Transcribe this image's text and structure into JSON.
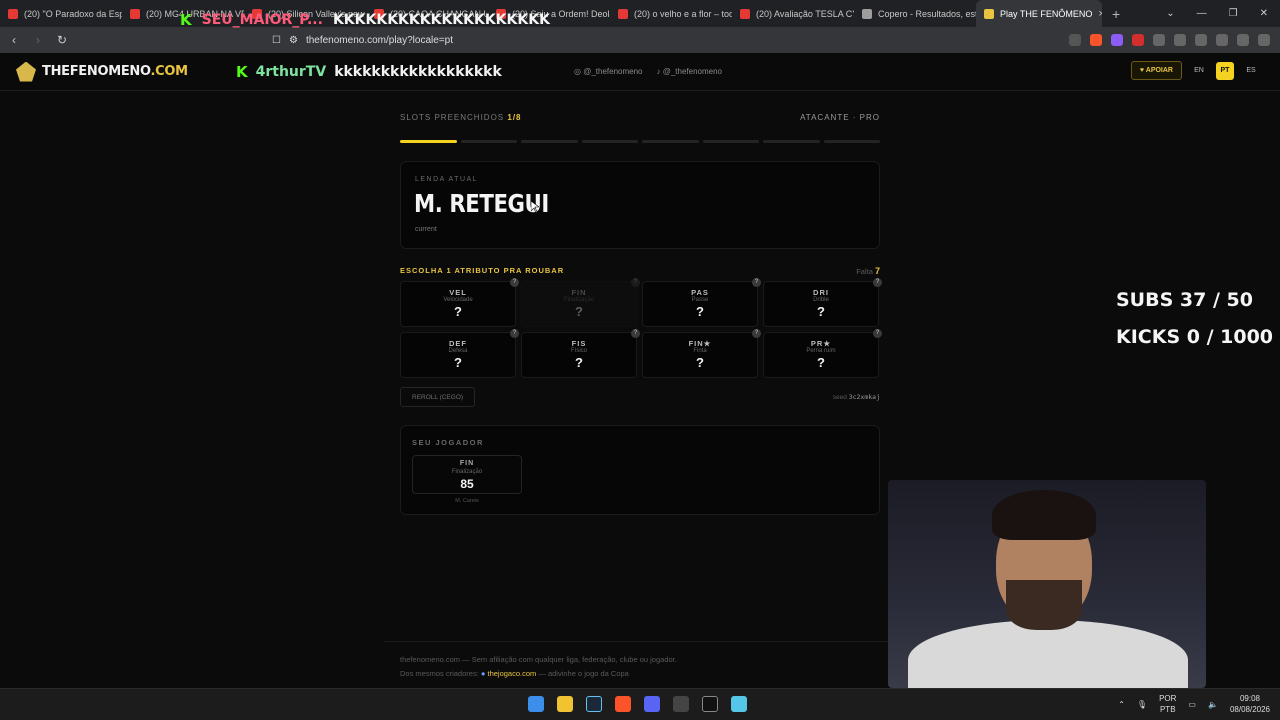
{
  "browser": {
    "tabs": [
      {
        "title": "(20) \"O Paradoxo da Espe",
        "color": "#e53935"
      },
      {
        "title": "(20) MG4 URBAN NA VE",
        "color": "#e53935"
      },
      {
        "title": "(20) Silicon Valley's new",
        "color": "#e53935"
      },
      {
        "title": "(20) CAOA CHANGAN UN",
        "color": "#e53935"
      },
      {
        "title": "(20) Saiu a Ordem! Deola",
        "color": "#e53935"
      },
      {
        "title": "(20) o velho e a flor – toq",
        "color": "#e53935"
      },
      {
        "title": "(20) Avaliação TESLA CYB",
        "color": "#e53935"
      },
      {
        "title": "Copero - Resultados, esta",
        "color": "#9e9e9e"
      }
    ],
    "active_tab": "Play THE FENÔMENO",
    "url": "thefenomeno.com/play?locale=pt"
  },
  "overlay": {
    "chat_user": "SEU_MAIOR_P...",
    "chat_msg": "KKKKKKKKKKKKKKKKKKKK",
    "subs": "SUBS 37 / 50",
    "kicks": "KICKS 0 / 1000"
  },
  "header": {
    "logo_main": "THEFENOMENO",
    "logo_dom": ".COM",
    "chat_user": "4rthurTV",
    "chat_msg": "kkkkkkkkkkkkkkkkkk",
    "social1": "@_thefenomeno",
    "social2": "@_thefenomeno",
    "apoiar": "♥ APOIAR",
    "langs": [
      "EN",
      "PT",
      "ES"
    ]
  },
  "game": {
    "slots_label": "SLOTS PREENCHIDOS",
    "slots_count": "1/8",
    "mode": "ATACANTE · PRO",
    "progress_filled": 1,
    "progress_total": 8,
    "legend_tag": "LENDA ATUAL",
    "legend_name": "M. RETEGUI",
    "legend_sub": "current",
    "steal_label": "ESCOLHA 1 ATRIBUTO PRA ROUBAR",
    "falta_label": "Falta",
    "falta_count": "7",
    "attributes": [
      {
        "ab": "VEL",
        "full": "Velocidade",
        "value": "?",
        "disabled": false
      },
      {
        "ab": "FIN",
        "full": "Finalização",
        "value": "?",
        "disabled": true
      },
      {
        "ab": "PAS",
        "full": "Passe",
        "value": "?",
        "disabled": false
      },
      {
        "ab": "DRI",
        "full": "Drible",
        "value": "?",
        "disabled": false
      },
      {
        "ab": "DEF",
        "full": "Defesa",
        "value": "?",
        "disabled": false
      },
      {
        "ab": "FIS",
        "full": "Físico",
        "value": "?",
        "disabled": false
      },
      {
        "ab": "FIN★",
        "full": "Finta",
        "value": "?",
        "disabled": false
      },
      {
        "ab": "PR★",
        "full": "Perna ruim",
        "value": "?",
        "disabled": false
      }
    ],
    "help_glyph": "?",
    "reroll_label": "REROLL (CEGO)",
    "seed_label": "seed",
    "seed_value": "3c2xmkaj",
    "player_title": "SEU JOGADOR",
    "player_stat": {
      "ab": "FIN",
      "full": "Finalização",
      "value": "85",
      "from": "M. Careis"
    }
  },
  "footer": {
    "line1": "thefenomeno.com — Sem afiliação com qualquer liga, federação, clube ou jogador.",
    "line2_prefix": "Dos mesmos criadores:",
    "line2_link": "thejogaco.com",
    "line2_suffix": "— adivinhe o jogo da Copa"
  },
  "taskbar": {
    "lang1": "POR",
    "lang2": "PTB",
    "time": "09:08",
    "date": "08/08/2026"
  },
  "colors": {
    "accent": "#f5d21f",
    "kick_green": "#53fc18"
  }
}
